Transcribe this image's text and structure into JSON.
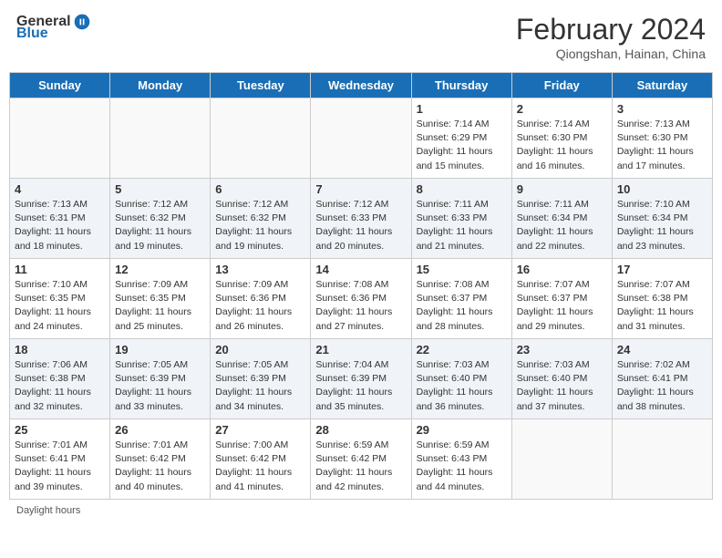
{
  "header": {
    "logo_general": "General",
    "logo_blue": "Blue",
    "month_title": "February 2024",
    "subtitle": "Qiongshan, Hainan, China"
  },
  "days_of_week": [
    "Sunday",
    "Monday",
    "Tuesday",
    "Wednesday",
    "Thursday",
    "Friday",
    "Saturday"
  ],
  "weeks": [
    [
      {
        "day": "",
        "info": ""
      },
      {
        "day": "",
        "info": ""
      },
      {
        "day": "",
        "info": ""
      },
      {
        "day": "",
        "info": ""
      },
      {
        "day": "1",
        "info": "Sunrise: 7:14 AM\nSunset: 6:29 PM\nDaylight: 11 hours and 15 minutes."
      },
      {
        "day": "2",
        "info": "Sunrise: 7:14 AM\nSunset: 6:30 PM\nDaylight: 11 hours and 16 minutes."
      },
      {
        "day": "3",
        "info": "Sunrise: 7:13 AM\nSunset: 6:30 PM\nDaylight: 11 hours and 17 minutes."
      }
    ],
    [
      {
        "day": "4",
        "info": "Sunrise: 7:13 AM\nSunset: 6:31 PM\nDaylight: 11 hours and 18 minutes."
      },
      {
        "day": "5",
        "info": "Sunrise: 7:12 AM\nSunset: 6:32 PM\nDaylight: 11 hours and 19 minutes."
      },
      {
        "day": "6",
        "info": "Sunrise: 7:12 AM\nSunset: 6:32 PM\nDaylight: 11 hours and 19 minutes."
      },
      {
        "day": "7",
        "info": "Sunrise: 7:12 AM\nSunset: 6:33 PM\nDaylight: 11 hours and 20 minutes."
      },
      {
        "day": "8",
        "info": "Sunrise: 7:11 AM\nSunset: 6:33 PM\nDaylight: 11 hours and 21 minutes."
      },
      {
        "day": "9",
        "info": "Sunrise: 7:11 AM\nSunset: 6:34 PM\nDaylight: 11 hours and 22 minutes."
      },
      {
        "day": "10",
        "info": "Sunrise: 7:10 AM\nSunset: 6:34 PM\nDaylight: 11 hours and 23 minutes."
      }
    ],
    [
      {
        "day": "11",
        "info": "Sunrise: 7:10 AM\nSunset: 6:35 PM\nDaylight: 11 hours and 24 minutes."
      },
      {
        "day": "12",
        "info": "Sunrise: 7:09 AM\nSunset: 6:35 PM\nDaylight: 11 hours and 25 minutes."
      },
      {
        "day": "13",
        "info": "Sunrise: 7:09 AM\nSunset: 6:36 PM\nDaylight: 11 hours and 26 minutes."
      },
      {
        "day": "14",
        "info": "Sunrise: 7:08 AM\nSunset: 6:36 PM\nDaylight: 11 hours and 27 minutes."
      },
      {
        "day": "15",
        "info": "Sunrise: 7:08 AM\nSunset: 6:37 PM\nDaylight: 11 hours and 28 minutes."
      },
      {
        "day": "16",
        "info": "Sunrise: 7:07 AM\nSunset: 6:37 PM\nDaylight: 11 hours and 29 minutes."
      },
      {
        "day": "17",
        "info": "Sunrise: 7:07 AM\nSunset: 6:38 PM\nDaylight: 11 hours and 31 minutes."
      }
    ],
    [
      {
        "day": "18",
        "info": "Sunrise: 7:06 AM\nSunset: 6:38 PM\nDaylight: 11 hours and 32 minutes."
      },
      {
        "day": "19",
        "info": "Sunrise: 7:05 AM\nSunset: 6:39 PM\nDaylight: 11 hours and 33 minutes."
      },
      {
        "day": "20",
        "info": "Sunrise: 7:05 AM\nSunset: 6:39 PM\nDaylight: 11 hours and 34 minutes."
      },
      {
        "day": "21",
        "info": "Sunrise: 7:04 AM\nSunset: 6:39 PM\nDaylight: 11 hours and 35 minutes."
      },
      {
        "day": "22",
        "info": "Sunrise: 7:03 AM\nSunset: 6:40 PM\nDaylight: 11 hours and 36 minutes."
      },
      {
        "day": "23",
        "info": "Sunrise: 7:03 AM\nSunset: 6:40 PM\nDaylight: 11 hours and 37 minutes."
      },
      {
        "day": "24",
        "info": "Sunrise: 7:02 AM\nSunset: 6:41 PM\nDaylight: 11 hours and 38 minutes."
      }
    ],
    [
      {
        "day": "25",
        "info": "Sunrise: 7:01 AM\nSunset: 6:41 PM\nDaylight: 11 hours and 39 minutes."
      },
      {
        "day": "26",
        "info": "Sunrise: 7:01 AM\nSunset: 6:42 PM\nDaylight: 11 hours and 40 minutes."
      },
      {
        "day": "27",
        "info": "Sunrise: 7:00 AM\nSunset: 6:42 PM\nDaylight: 11 hours and 41 minutes."
      },
      {
        "day": "28",
        "info": "Sunrise: 6:59 AM\nSunset: 6:42 PM\nDaylight: 11 hours and 42 minutes."
      },
      {
        "day": "29",
        "info": "Sunrise: 6:59 AM\nSunset: 6:43 PM\nDaylight: 11 hours and 44 minutes."
      },
      {
        "day": "",
        "info": ""
      },
      {
        "day": "",
        "info": ""
      }
    ]
  ],
  "footer": {
    "daylight_label": "Daylight hours"
  }
}
